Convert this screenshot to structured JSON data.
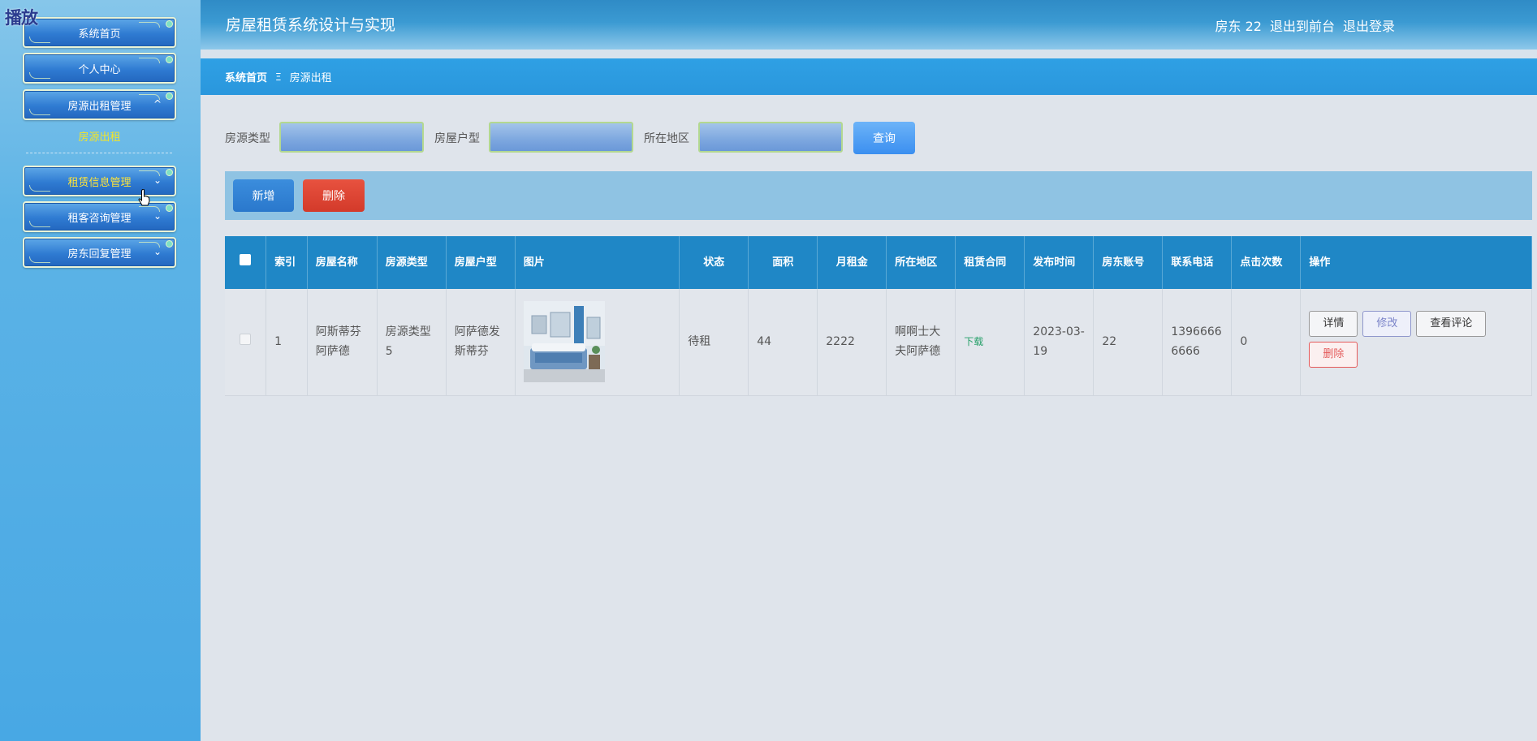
{
  "overlay": {
    "play_label": "播放"
  },
  "sidebar": {
    "menu": [
      {
        "label": "系统首页",
        "has_chevron": false,
        "active": false
      },
      {
        "label": "个人中心",
        "has_chevron": false,
        "active": false
      },
      {
        "label": "房源出租管理",
        "has_chevron": true,
        "chevron": "^",
        "active": false
      },
      {
        "label": "租赁信息管理",
        "has_chevron": true,
        "chevron": "v",
        "active": true
      },
      {
        "label": "租客咨询管理",
        "has_chevron": true,
        "chevron": "v",
        "active": false
      },
      {
        "label": "房东回复管理",
        "has_chevron": true,
        "chevron": "v",
        "active": false
      }
    ],
    "submenu": {
      "label": "房源出租"
    }
  },
  "header": {
    "title": "房屋租赁系统设计与实现",
    "user_label": "房东 22",
    "front_link": "退出到前台",
    "logout_link": "退出登录"
  },
  "breadcrumb": {
    "home": "系统首页",
    "separator": "Ξ",
    "current": "房源出租"
  },
  "search": {
    "fields": [
      {
        "label": "房源类型",
        "placeholder": "",
        "value": ""
      },
      {
        "label": "房屋户型",
        "placeholder": "",
        "value": ""
      },
      {
        "label": "所在地区",
        "placeholder": "",
        "value": ""
      }
    ],
    "query_button": "查询"
  },
  "actions": {
    "add_button": "新增",
    "delete_button": "删除"
  },
  "table": {
    "columns": [
      "索引",
      "房屋名称",
      "房源类型",
      "房屋户型",
      "图片",
      "状态",
      "面积",
      "月租金",
      "所在地区",
      "租赁合同",
      "发布时间",
      "房东账号",
      "联系电话",
      "点击次数",
      "操作"
    ],
    "rows": [
      {
        "index": "1",
        "name": "阿斯蒂芬阿萨德",
        "type": "房源类型5",
        "layout": "阿萨德发斯蒂芬",
        "status": "待租",
        "area": "44",
        "rent": "2222",
        "region": "啊啊士大夫阿萨德",
        "contract": "下载",
        "published": "2023-03-19",
        "landlord": "22",
        "phone": "13966666666",
        "clicks": "0",
        "ops": {
          "detail": "详情",
          "edit": "修改",
          "comments": "查看评论",
          "remove": "删除"
        }
      }
    ]
  },
  "colors": {
    "header_blue": "#2f8bc6",
    "breadcrumb_blue": "#2a97dd",
    "table_header": "#1f87c6",
    "delete_red": "#d33a2a",
    "active_menu_text": "#ffe438"
  }
}
